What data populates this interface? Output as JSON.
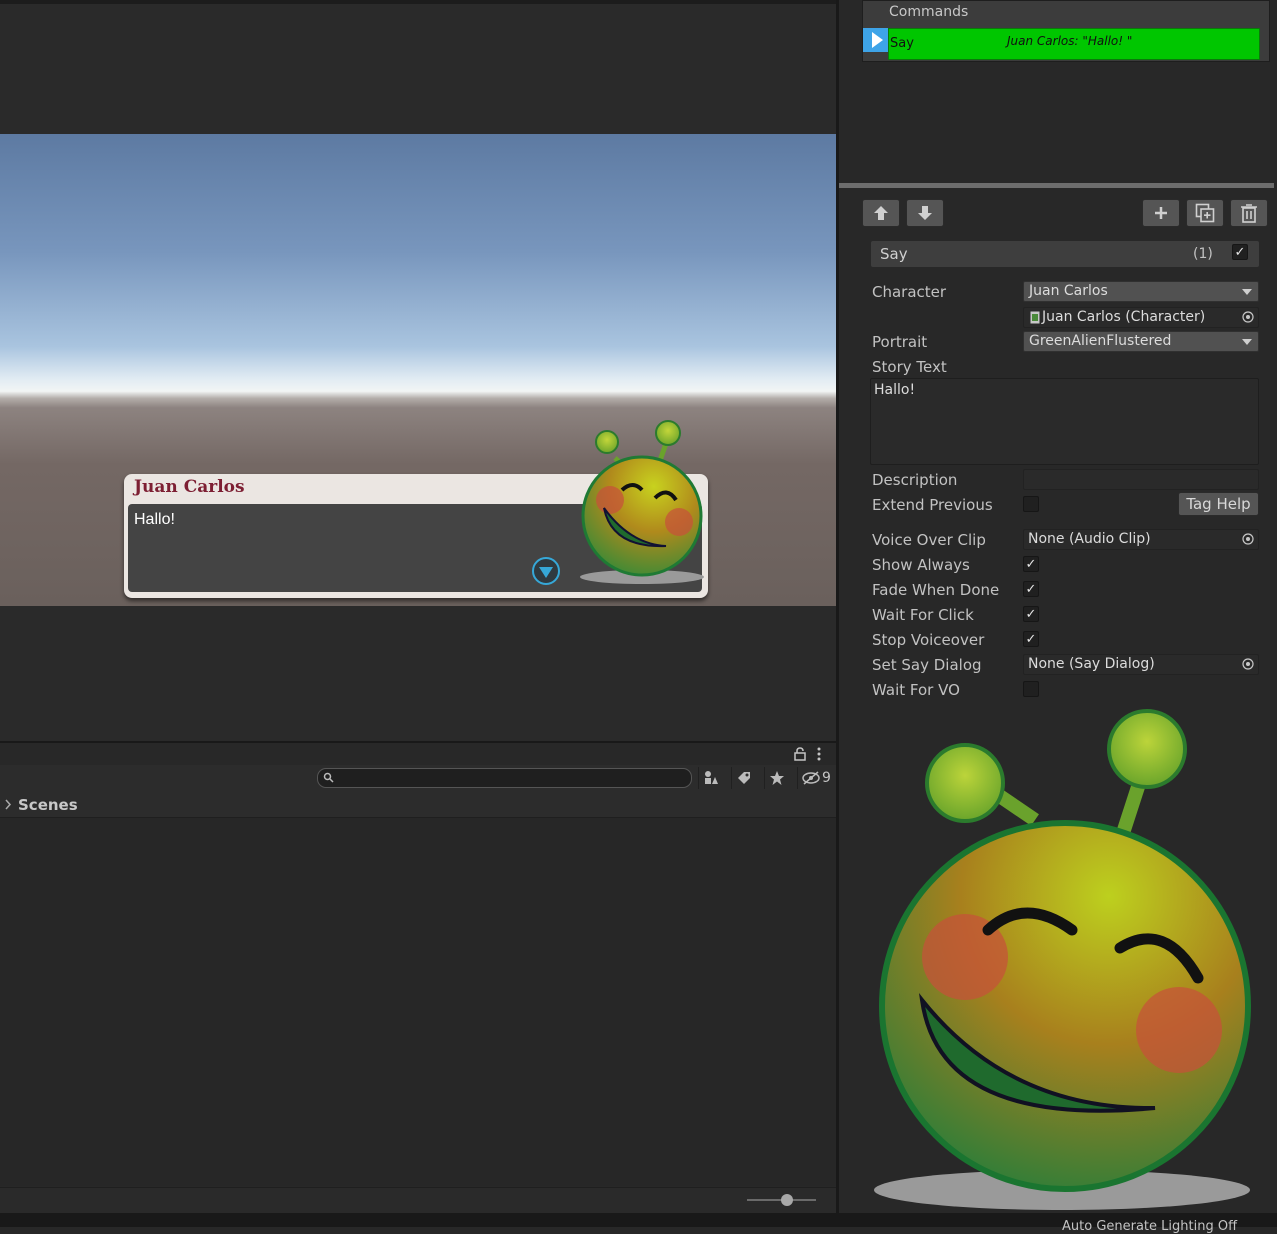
{
  "game": {
    "character_name": "Juan Carlos",
    "story_text": "Hallo!"
  },
  "project": {
    "search_placeholder": "",
    "hidden_count": "9",
    "scenes_label": "Scenes"
  },
  "status": {
    "text": "Auto Generate Lighting Off"
  },
  "commands": {
    "title": "Commands",
    "rows": [
      {
        "name": "Say",
        "summary": "Juan Carlos: \"Hallo! \"",
        "color": "#00c600"
      }
    ]
  },
  "inspector": {
    "command_name": "Say",
    "command_index": "(1)",
    "command_enabled": true,
    "fields": {
      "character_label": "Character",
      "character_value": "Juan Carlos",
      "character_object": "Juan Carlos (Character)",
      "portrait_label": "Portrait",
      "portrait_value": "GreenAlienFlustered",
      "story_text_label": "Story Text",
      "story_text_value": "Hallo!",
      "description_label": "Description",
      "description_value": "",
      "extend_previous_label": "Extend Previous",
      "tag_help_label": "Tag Help",
      "voice_over_clip_label": "Voice Over Clip",
      "voice_over_clip_value": "None (Audio Clip)",
      "show_always_label": "Show Always",
      "fade_when_done_label": "Fade When Done",
      "wait_for_click_label": "Wait For Click",
      "stop_voiceover_label": "Stop Voiceover",
      "set_say_dialog_label": "Set Say Dialog",
      "set_say_dialog_value": "None (Say Dialog)",
      "wait_for_vo_label": "Wait For VO"
    },
    "checks": {
      "extend_previous": false,
      "show_always": true,
      "fade_when_done": true,
      "wait_for_click": true,
      "stop_voiceover": true,
      "wait_for_vo": false
    },
    "check_mark": "✓"
  },
  "colors": {
    "command_row": "#00c600",
    "name_color": "#7d1f33",
    "accent_blue": "#3ea4e8"
  },
  "icons": [
    "lock-icon",
    "kebab-menu-icon",
    "search-icon",
    "filter-by-type-icon",
    "filter-by-label-icon",
    "favorites-icon",
    "hidden-packages-icon",
    "move-up-icon",
    "move-down-icon",
    "add-command-icon",
    "duplicate-command-icon",
    "delete-command-icon",
    "object-picker-icon",
    "continue-arrow-icon",
    "alien-portrait-icon"
  ]
}
